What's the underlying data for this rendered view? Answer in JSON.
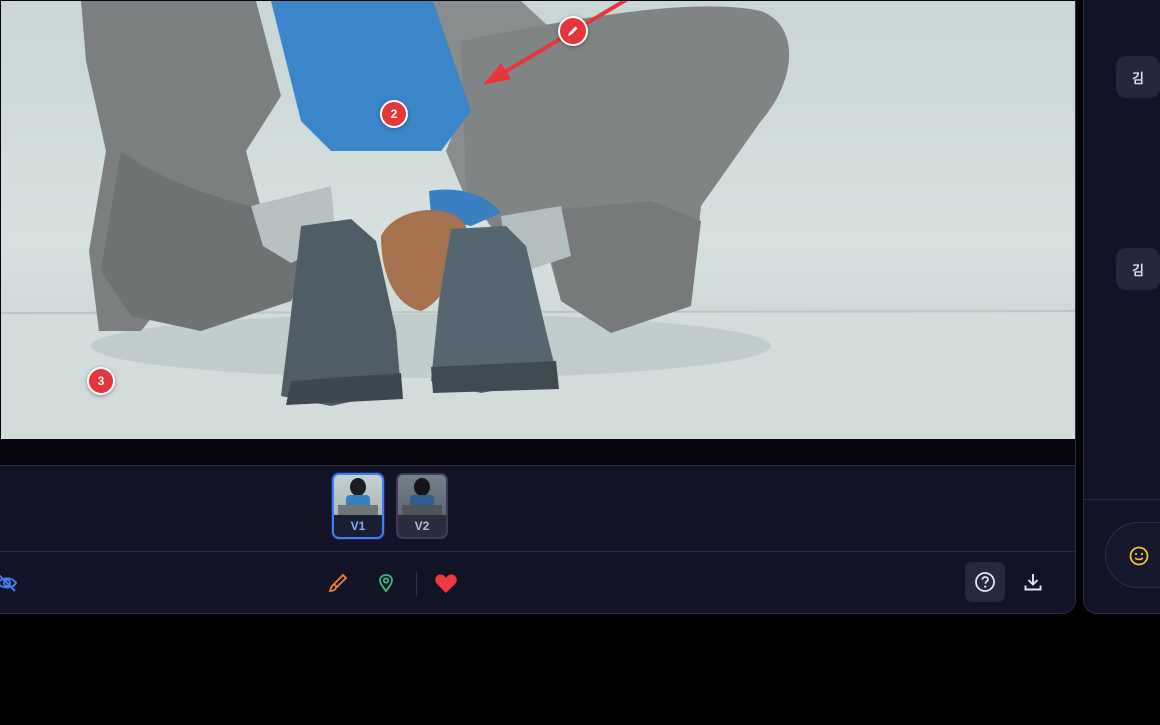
{
  "canvas": {
    "pins": [
      {
        "id": "pin-2",
        "label": "2"
      },
      {
        "id": "pin-3",
        "label": "3"
      }
    ],
    "pen_marker_icon": "pencil-icon",
    "arrow_color": "#e5363c"
  },
  "versions": [
    {
      "label": "V1",
      "selected": true
    },
    {
      "label": "V2",
      "selected": false
    }
  ],
  "toolbar": {
    "left_icon": "eye-off-icon",
    "tools": [
      "brush-icon",
      "map-pin-icon",
      "heart-icon"
    ],
    "right_tools": [
      "help-icon",
      "download-icon"
    ],
    "colors": {
      "brush": "#e8843a",
      "pin": "#3fba7a",
      "heart": "#ef3a42",
      "accent": "#3f7df2"
    }
  },
  "comments": {
    "avatars": [
      {
        "initial": "김"
      },
      {
        "initial": "김"
      }
    ],
    "composer_icon": "smile-icon",
    "composer_icon_color": "#f2c230"
  }
}
